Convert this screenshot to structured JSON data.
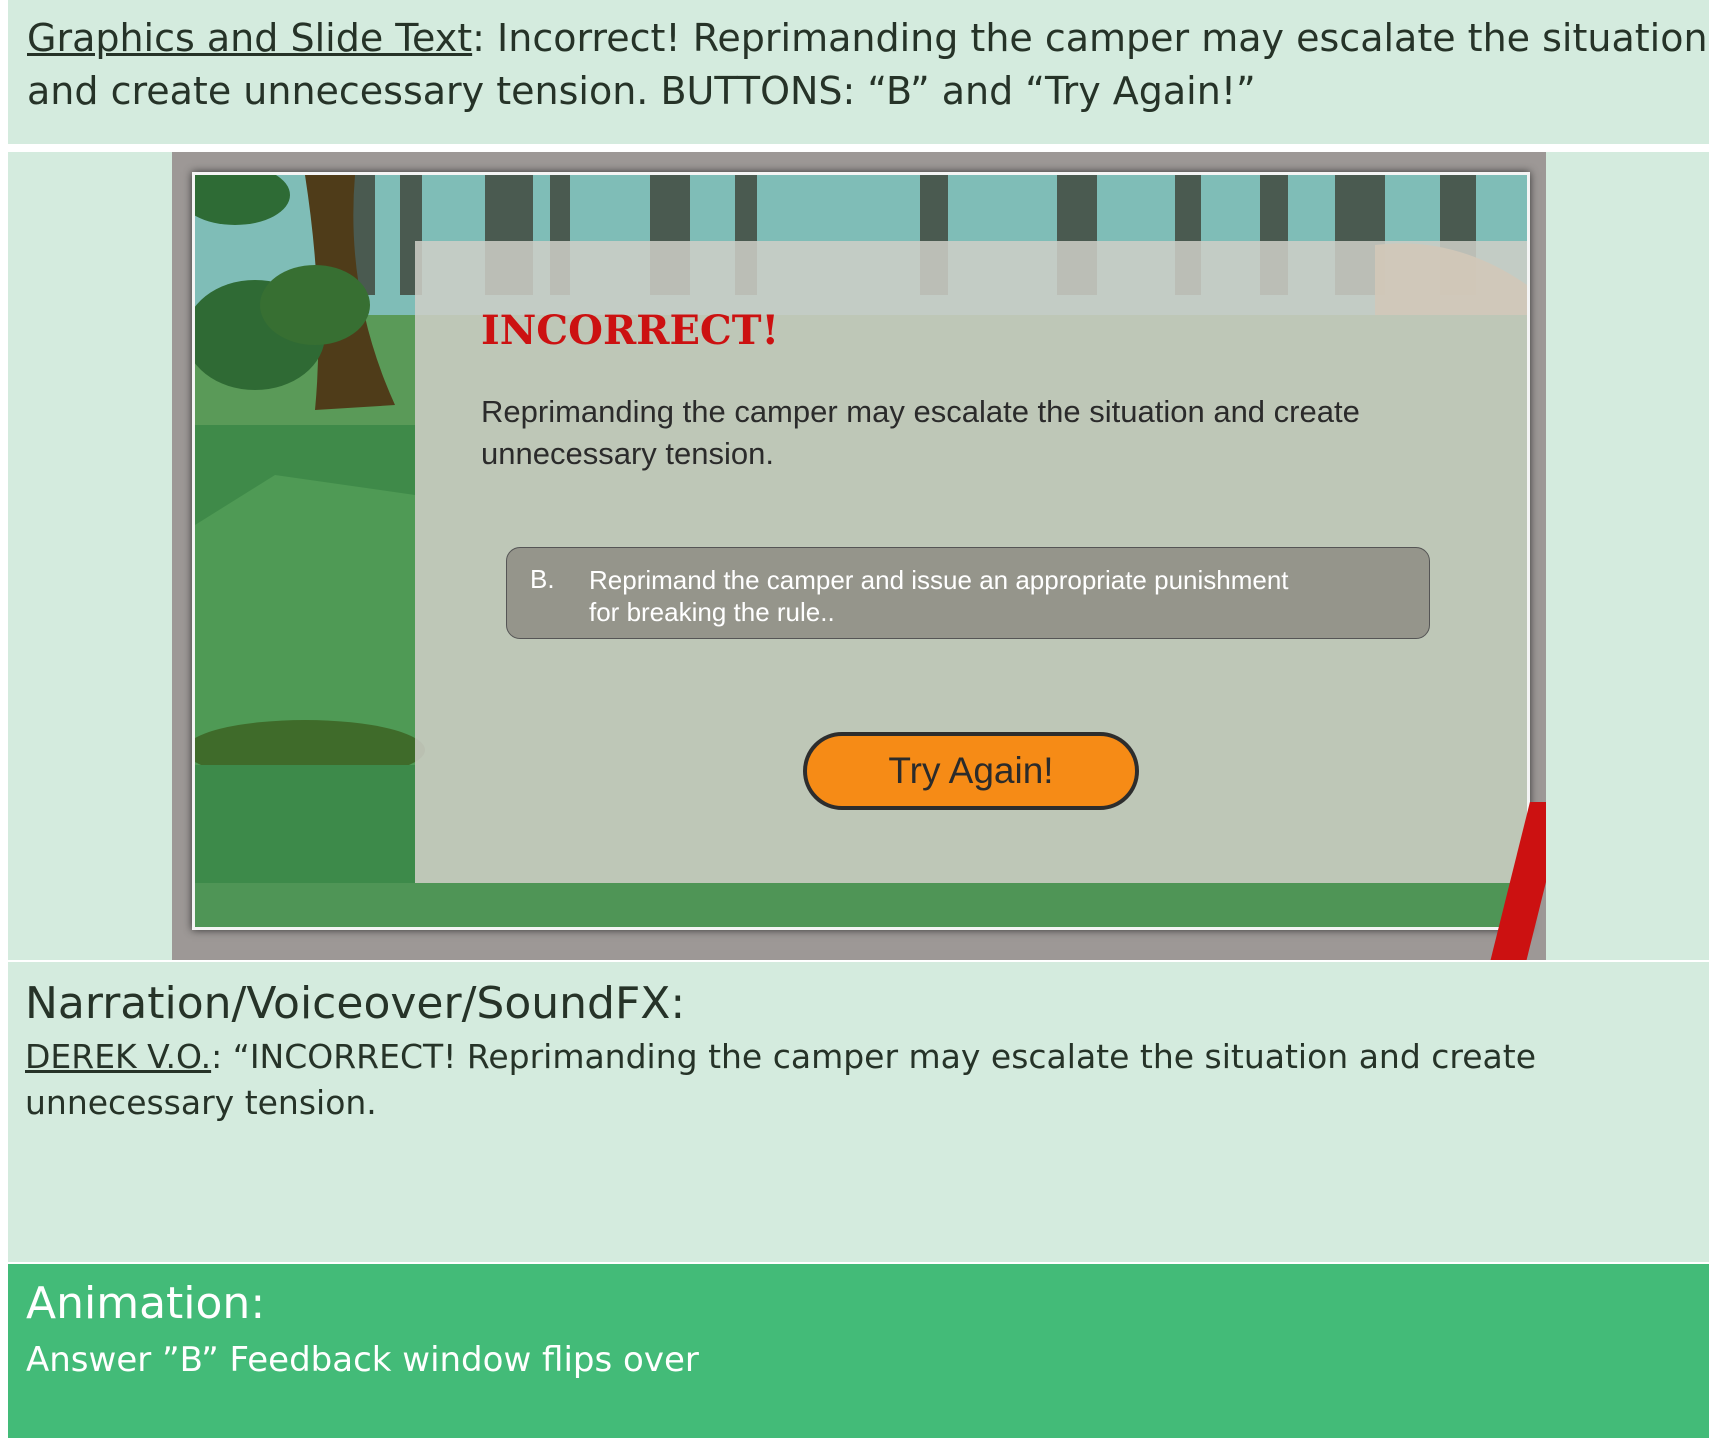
{
  "graphics": {
    "header": "Graphics and Slide Text",
    "colon": ":",
    "body": " Incorrect! Reprimanding the camper may escalate the situation and create unnecessary tension. BUTTONS: “B” and “Try Again!”"
  },
  "slide": {
    "title": "INCORRECT!",
    "body": "Reprimanding the camper may escalate the situation and create unnecessary tension.",
    "answer_letter": "B.",
    "answer_text": "Reprimand the camper and issue an appropriate punishment for breaking the rule..",
    "try_again": "Try Again!"
  },
  "narration": {
    "header": "Narration/Voiceover/SoundFX:",
    "speaker": "DEREK V.O.",
    "colon": ":",
    "line": " “INCORRECT! Reprimanding the camper may escalate the situation and create unnecessary tension."
  },
  "animation": {
    "header": "Animation:",
    "body": "Answer ”B” Feedback window flips over"
  },
  "colors": {
    "band_light": "#d4ebde",
    "band_green": "#43bb78",
    "title_red": "#cc1111",
    "button_orange": "#f68b16"
  }
}
